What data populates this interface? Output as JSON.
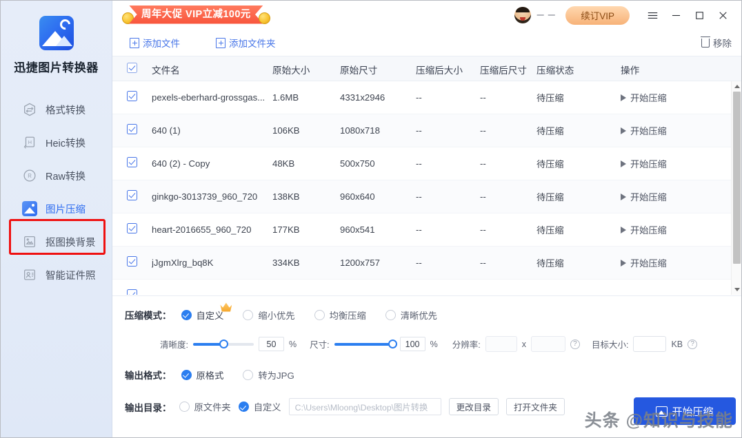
{
  "sidebar": {
    "app_title": "迅捷图片转换器",
    "logo_icon": "image-convert-logo",
    "items": [
      {
        "label": "格式转换",
        "icon": "format-convert-icon",
        "active": false
      },
      {
        "label": "Heic转换",
        "icon": "heic-convert-icon",
        "active": false
      },
      {
        "label": "Raw转换",
        "icon": "raw-convert-icon",
        "active": false
      },
      {
        "label": "图片压缩",
        "icon": "image-compress-icon",
        "active": true
      },
      {
        "label": "抠图换背景",
        "icon": "remove-background-icon",
        "active": false
      },
      {
        "label": "智能证件照",
        "icon": "id-photo-icon",
        "active": false
      }
    ]
  },
  "topbar": {
    "promo_text": "周年大促 VIP立减100元",
    "promo_bg": "#f8553c",
    "username": "一 一",
    "vip_button": "续订VIP",
    "vip_bg": "#f7b278",
    "menu_icon": "hamburger-menu-icon",
    "minimize_icon": "minimize-icon",
    "maximize_icon": "maximize-icon",
    "close_icon": "close-icon"
  },
  "actionbar": {
    "add_file": "添加文件",
    "add_folder": "添加文件夹",
    "remove": "移除"
  },
  "table": {
    "headers": {
      "name": "文件名",
      "orig_size": "原始大小",
      "orig_dim": "原始尺寸",
      "comp_size": "压缩后大小",
      "comp_dim": "压缩后尺寸",
      "status": "压缩状态",
      "action": "操作"
    },
    "action_label": "开始压缩",
    "rows": [
      {
        "name": "pexels-eberhard-grossgas...",
        "orig_size": "1.6MB",
        "orig_dim": "4331x2946",
        "comp_size": "--",
        "comp_dim": "--",
        "status": "待压缩",
        "checked": true
      },
      {
        "name": "640 (1)",
        "orig_size": "106KB",
        "orig_dim": "1080x718",
        "comp_size": "--",
        "comp_dim": "--",
        "status": "待压缩",
        "checked": true
      },
      {
        "name": "640 (2) - Copy",
        "orig_size": "48KB",
        "orig_dim": "500x750",
        "comp_size": "--",
        "comp_dim": "--",
        "status": "待压缩",
        "checked": true
      },
      {
        "name": "ginkgo-3013739_960_720",
        "orig_size": "138KB",
        "orig_dim": "960x640",
        "comp_size": "--",
        "comp_dim": "--",
        "status": "待压缩",
        "checked": true
      },
      {
        "name": "heart-2016655_960_720",
        "orig_size": "177KB",
        "orig_dim": "960x541",
        "comp_size": "--",
        "comp_dim": "--",
        "status": "待压缩",
        "checked": true
      },
      {
        "name": "jJgmXlrg_bq8K",
        "orig_size": "334KB",
        "orig_dim": "1200x757",
        "comp_size": "--",
        "comp_dim": "--",
        "status": "待压缩",
        "checked": true
      }
    ]
  },
  "settings": {
    "mode_label": "压缩模式：",
    "mode_options": [
      {
        "label": "自定义",
        "selected": true,
        "vip": true
      },
      {
        "label": "缩小优先",
        "selected": false,
        "vip": false
      },
      {
        "label": "均衡压缩",
        "selected": false,
        "vip": false
      },
      {
        "label": "清晰优先",
        "selected": false,
        "vip": false
      }
    ],
    "clarity_label": "清晰度:",
    "clarity_value": "50",
    "clarity_unit": "%",
    "size_label": "尺寸:",
    "size_value": "100",
    "size_unit": "%",
    "resolution_label": "分辨率:",
    "resolution_w": "",
    "resolution_h": "",
    "resolution_x": "x",
    "target_label": "目标大小:",
    "target_value": "",
    "target_unit": "KB",
    "help_icon": "question-mark-icon",
    "format_label": "输出格式：",
    "format_options": [
      {
        "label": "原格式",
        "selected": true
      },
      {
        "label": "转为JPG",
        "selected": false
      }
    ],
    "outdir_label": "输出目录：",
    "outdir_options": [
      {
        "label": "原文件夹",
        "selected": false
      },
      {
        "label": "自定义",
        "selected": true
      }
    ],
    "path_value": "C:\\Users\\Mloong\\Desktop\\图片转换",
    "change_dir": "更改目录",
    "open_folder": "打开文件夹",
    "start_button": "开始压缩",
    "start_bg": "#2558e0"
  },
  "watermark": {
    "text": "头条 @知识与技能"
  }
}
